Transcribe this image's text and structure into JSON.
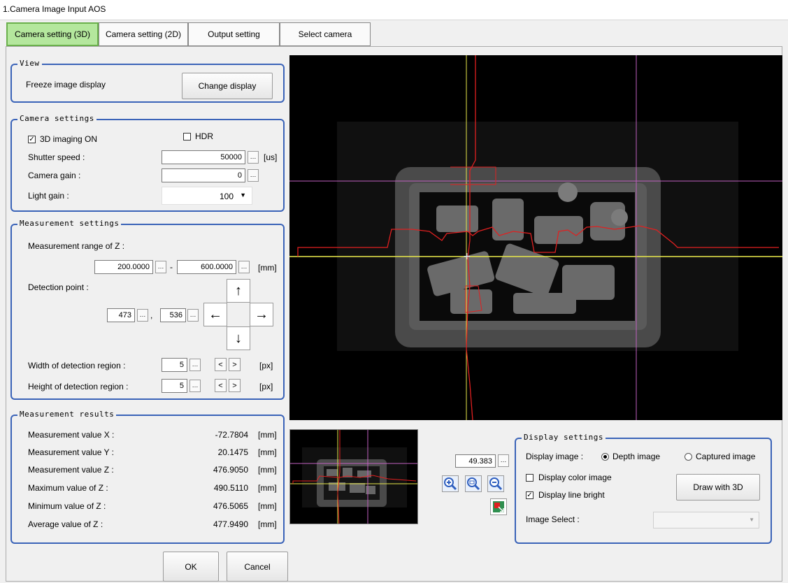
{
  "window": {
    "title": "1.Camera Image Input AOS"
  },
  "tabs": [
    "Camera setting (3D)",
    "Camera setting (2D)",
    "Output setting",
    "Select camera"
  ],
  "view_group": {
    "title": "View",
    "freeze_label": "Freeze image display",
    "change_display": "Change display"
  },
  "camera_settings": {
    "title": "Camera settings",
    "imaging_3d": {
      "label": "3D imaging ON",
      "checked": true
    },
    "hdr": {
      "label": "HDR",
      "checked": false
    },
    "shutter_speed": {
      "label": "Shutter speed :",
      "value": "50000",
      "unit": "[us]"
    },
    "camera_gain": {
      "label": "Camera gain :",
      "value": "0"
    },
    "light_gain": {
      "label": "Light gain :",
      "value": "100"
    }
  },
  "measurement_settings": {
    "title": "Measurement settings",
    "range_label": "Measurement range of Z :",
    "range_min": "200.0000",
    "range_sep": "-",
    "range_max": "600.0000",
    "range_unit": "[mm]",
    "detection_label": "Detection point :",
    "detection_x": "473",
    "detection_comma": ",",
    "detection_y": "536",
    "arrows": {
      "up": "↑",
      "down": "↓",
      "left": "←",
      "right": "→"
    },
    "width_label": "Width of detection region :",
    "width_value": "5",
    "height_label": "Height of detection region :",
    "height_value": "5",
    "dec": "<",
    "inc": ">",
    "px_unit": "[px]"
  },
  "measurement_results": {
    "title": "Measurement results",
    "unit": "[mm]",
    "rows": [
      {
        "label": "Measurement value X :",
        "value": "-72.7804"
      },
      {
        "label": "Measurement value Y :",
        "value": "20.1475"
      },
      {
        "label": "Measurement value Z :",
        "value": "476.9050"
      },
      {
        "label": "Maximum value of Z :",
        "value": "490.5110"
      },
      {
        "label": "Minimum value of Z :",
        "value": "476.5065"
      },
      {
        "label": "Average value of Z :",
        "value": "477.9490"
      }
    ]
  },
  "zoom": {
    "value": "49.383"
  },
  "display_settings": {
    "title": "Display settings",
    "display_image_label": "Display image :",
    "depth_image": {
      "label": "Depth image",
      "selected": true
    },
    "captured_image": {
      "label": "Captured image",
      "selected": false
    },
    "color_image": {
      "label": "Display color image",
      "checked": false
    },
    "line_bright": {
      "label": "Display line bright",
      "checked": true
    },
    "draw_3d": "Draw with 3D",
    "image_select_label": "Image Select :"
  },
  "footer": {
    "ok": "OK",
    "cancel": "Cancel"
  },
  "colors": {
    "accent_blue": "#3a63b8",
    "active_tab": "#b4e79d",
    "crosshair_yellow": "#e8e84a",
    "crosshair_magenta": "#c060c0",
    "profile_red": "#e02020"
  },
  "icons": [
    "zoom-in-icon",
    "zoom-fit-icon",
    "zoom-out-icon",
    "fit-to-window-icon",
    "dropdown-arrow-icon"
  ]
}
